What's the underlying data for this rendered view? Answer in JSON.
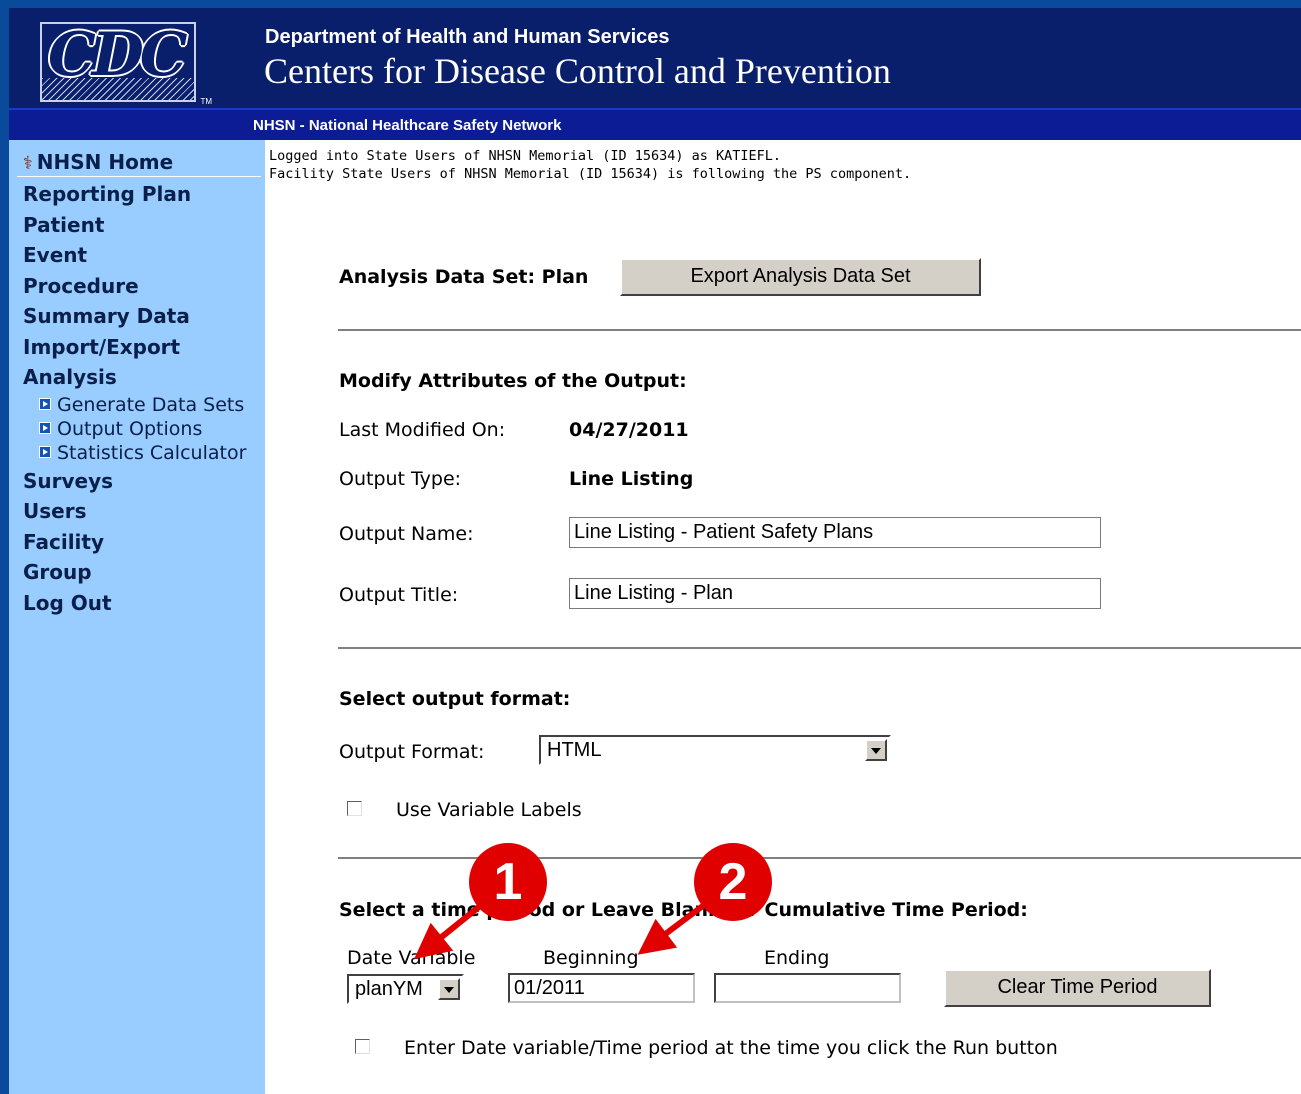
{
  "header": {
    "logo_text": "CDC",
    "logo_tm": "TM",
    "department": "Department of Health and Human Services",
    "agency": "Centers for Disease Control and Prevention",
    "network": "NHSN - National Healthcare Safety Network"
  },
  "sidebar": {
    "home": "NHSN Home",
    "items": [
      "Reporting Plan",
      "Patient",
      "Event",
      "Procedure",
      "Summary Data",
      "Import/Export",
      "Analysis"
    ],
    "analysis_sub": [
      "Generate Data Sets",
      "Output Options",
      "Statistics Calculator"
    ],
    "items_after": [
      "Surveys",
      "Users",
      "Facility",
      "Group",
      "Log Out"
    ]
  },
  "login": {
    "line1": "Logged into State Users of NHSN Memorial (ID 15634) as KATIEFL.",
    "line2": "Facility State Users of NHSN Memorial (ID 15634) is following the PS component."
  },
  "dataset": {
    "label": "Analysis Data Set: Plan",
    "export_button": "Export Analysis Data Set"
  },
  "attributes": {
    "heading": "Modify Attributes of the Output:",
    "last_modified_label": "Last Modified On:",
    "last_modified_value": "04/27/2011",
    "output_type_label": "Output Type:",
    "output_type_value": "Line Listing",
    "output_name_label": "Output Name:",
    "output_name_value": "Line Listing - Patient Safety Plans",
    "output_title_label": "Output Title:",
    "output_title_value": "Line Listing - Plan"
  },
  "format": {
    "heading": "Select output format:",
    "label": "Output Format:",
    "value": "HTML",
    "use_labels": "Use Variable Labels",
    "use_labels_checked": false
  },
  "time_period": {
    "heading": "Select a time period or Leave Blank for Cumulative Time Period:",
    "date_variable_label": "Date Variable",
    "date_variable_value": "planYM",
    "beginning_label": "Beginning",
    "beginning_value": "01/2011",
    "ending_label": "Ending",
    "ending_value": "",
    "clear_button": "Clear Time Period",
    "run_option": "Enter Date variable/Time period at the time you click the Run button",
    "run_option_checked": false
  },
  "callouts": [
    "1",
    "2"
  ],
  "colors": {
    "header_bg": "#0a1f6b",
    "network_bar": "#0b1c95",
    "sidebar_bg": "#99ccff",
    "callout_red": "#e00000"
  }
}
